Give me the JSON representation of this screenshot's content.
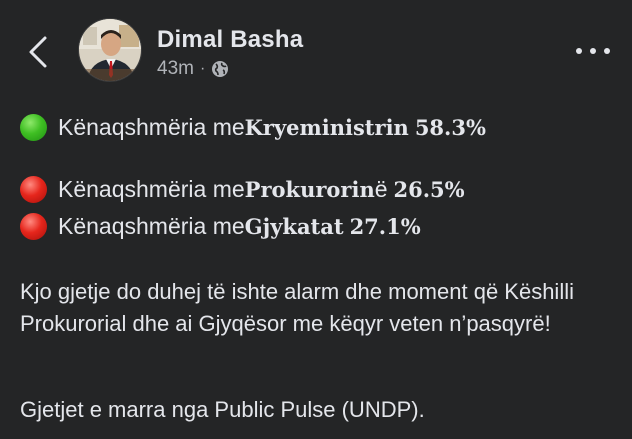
{
  "header": {
    "author_name": "Dimal Basha",
    "timestamp": "43m",
    "separator": "·",
    "privacy_icon": "globe-icon",
    "back_icon": "chevron-left-icon",
    "more_icon": "more-horizontal-icon"
  },
  "post": {
    "stats": [
      {
        "indicator": "green-circle",
        "prefix": "Kënaqshmëria me ",
        "subject": "Kryeministrin",
        "suffix": "",
        "value": "58.3%"
      },
      {
        "indicator": "red-circle",
        "prefix": "Kënaqshmëria me",
        "subject": "Prokurorin",
        "suffix": "ë",
        "value": "26.5%"
      },
      {
        "indicator": "red-circle",
        "prefix": "Kënaqshmëria me ",
        "subject": "Gjykatat",
        "suffix": "",
        "value": "27.1%"
      }
    ],
    "paragraph1": "Kjo gjetje do duhej të ishte alarm dhe moment që Këshilli Prokurorial dhe ai Gjyqësor me këqyr veten n’pasqyrë!",
    "paragraph2": "Gjetjet e marra nga Public Pulse (UNDP)."
  },
  "colors": {
    "background": "#242526",
    "text_primary": "#e4e6eb",
    "text_secondary": "#b0b3b8",
    "green_indicator": "#3fbf23",
    "red_indicator": "#e6261c"
  }
}
